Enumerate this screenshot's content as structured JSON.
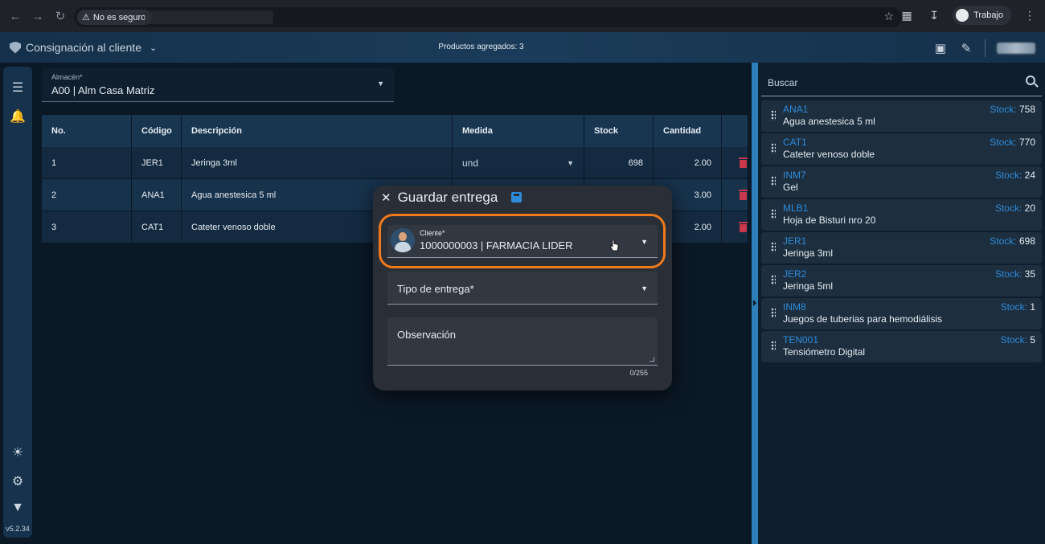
{
  "browser": {
    "security_label": "No es seguro",
    "profile_label": "Trabajo"
  },
  "appbar": {
    "title": "Consignación al cliente",
    "products_added": "Productos agregados: 3"
  },
  "rail": {
    "version": "v5.2.34"
  },
  "almacen": {
    "label": "Almacén*",
    "value": "A00 | Alm Casa Matriz"
  },
  "table": {
    "headers": [
      "No.",
      "Código",
      "Descripción",
      "Medida",
      "Stock",
      "Cantidad"
    ],
    "rows": [
      {
        "no": "1",
        "codigo": "JER1",
        "descripcion": "Jeringa 3ml",
        "medida": "und",
        "stock": "698",
        "cantidad": "2.00"
      },
      {
        "no": "2",
        "codigo": "ANA1",
        "descripcion": "Agua anestesica 5 ml",
        "medida": "",
        "stock": "",
        "cantidad": "3.00"
      },
      {
        "no": "3",
        "codigo": "CAT1",
        "descripcion": "Cateter venoso doble",
        "medida": "",
        "stock": "",
        "cantidad": "2.00"
      }
    ]
  },
  "dialog": {
    "title": "Guardar entrega",
    "cliente_label": "Cliente*",
    "cliente_value": "1000000003 | FARMACIA LIDER",
    "tipo_label": "Tipo de entrega*",
    "obs_label": "Observación",
    "obs_counter": "0/255"
  },
  "search": {
    "placeholder": "Buscar"
  },
  "stock_label": "Stock:",
  "products": [
    {
      "code": "ANA1",
      "desc": "Agua anestesica 5 ml",
      "stock": "758"
    },
    {
      "code": "CAT1",
      "desc": "Cateter venoso doble",
      "stock": "770"
    },
    {
      "code": "INM7",
      "desc": "Gel",
      "stock": "24"
    },
    {
      "code": "MLB1",
      "desc": "Hoja de Bisturi nro 20",
      "stock": "20"
    },
    {
      "code": "JER1",
      "desc": "Jeringa 3ml",
      "stock": "698"
    },
    {
      "code": "JER2",
      "desc": "Jeringa 5ml",
      "stock": "35"
    },
    {
      "code": "INM8",
      "desc": "Juegos de tuberias para hemodiálisis",
      "stock": "1"
    },
    {
      "code": "TEN001",
      "desc": "Tensiómetro Digital",
      "stock": "5"
    }
  ],
  "colors": {
    "accent": "#2e8bdb",
    "highlight": "#f07a1a",
    "delete": "#c6384a"
  }
}
